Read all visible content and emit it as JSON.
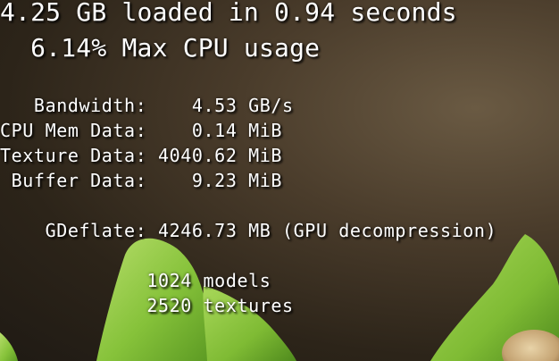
{
  "summary": {
    "loaded": "4.25 GB loaded in 0.94 seconds",
    "cpu": "  6.14% Max CPU usage"
  },
  "stats": {
    "bandwidth": "   Bandwidth:    4.53 GB/s",
    "cpu_mem": "CPU Mem Data:    0.14 MiB",
    "texture": "Texture Data: 4040.62 MiB",
    "buffer": " Buffer Data:    9.23 MiB"
  },
  "gdeflate": "    GDeflate: 4246.73 MB (GPU decompression)",
  "counts": {
    "models": "             1024 models",
    "textures": "             2520 textures"
  },
  "colors": {
    "text": "#ffffff",
    "avocado_green": "#8ec63f",
    "background": "#3a2f22"
  }
}
